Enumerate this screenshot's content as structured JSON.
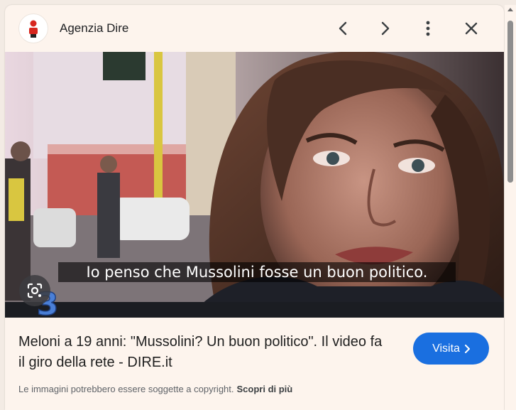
{
  "header": {
    "site_name": "Agenzia Dire"
  },
  "media": {
    "subtitle": "Io penso che Mussolini fosse un buon politico.",
    "channel_mark": "3"
  },
  "result": {
    "title": "Meloni a 19 anni: \"Mussolini? Un buon politico\". Il video fa il giro della rete - DIRE.it",
    "visit_label": "Visita"
  },
  "footer": {
    "copyright_note": "Le immagini potrebbero essere soggette a copyright.",
    "learn_more": "Scopri di più"
  },
  "colors": {
    "accent": "#1a6fe0",
    "logo_red": "#d7261e",
    "panel_bg": "#fdf4ed"
  }
}
